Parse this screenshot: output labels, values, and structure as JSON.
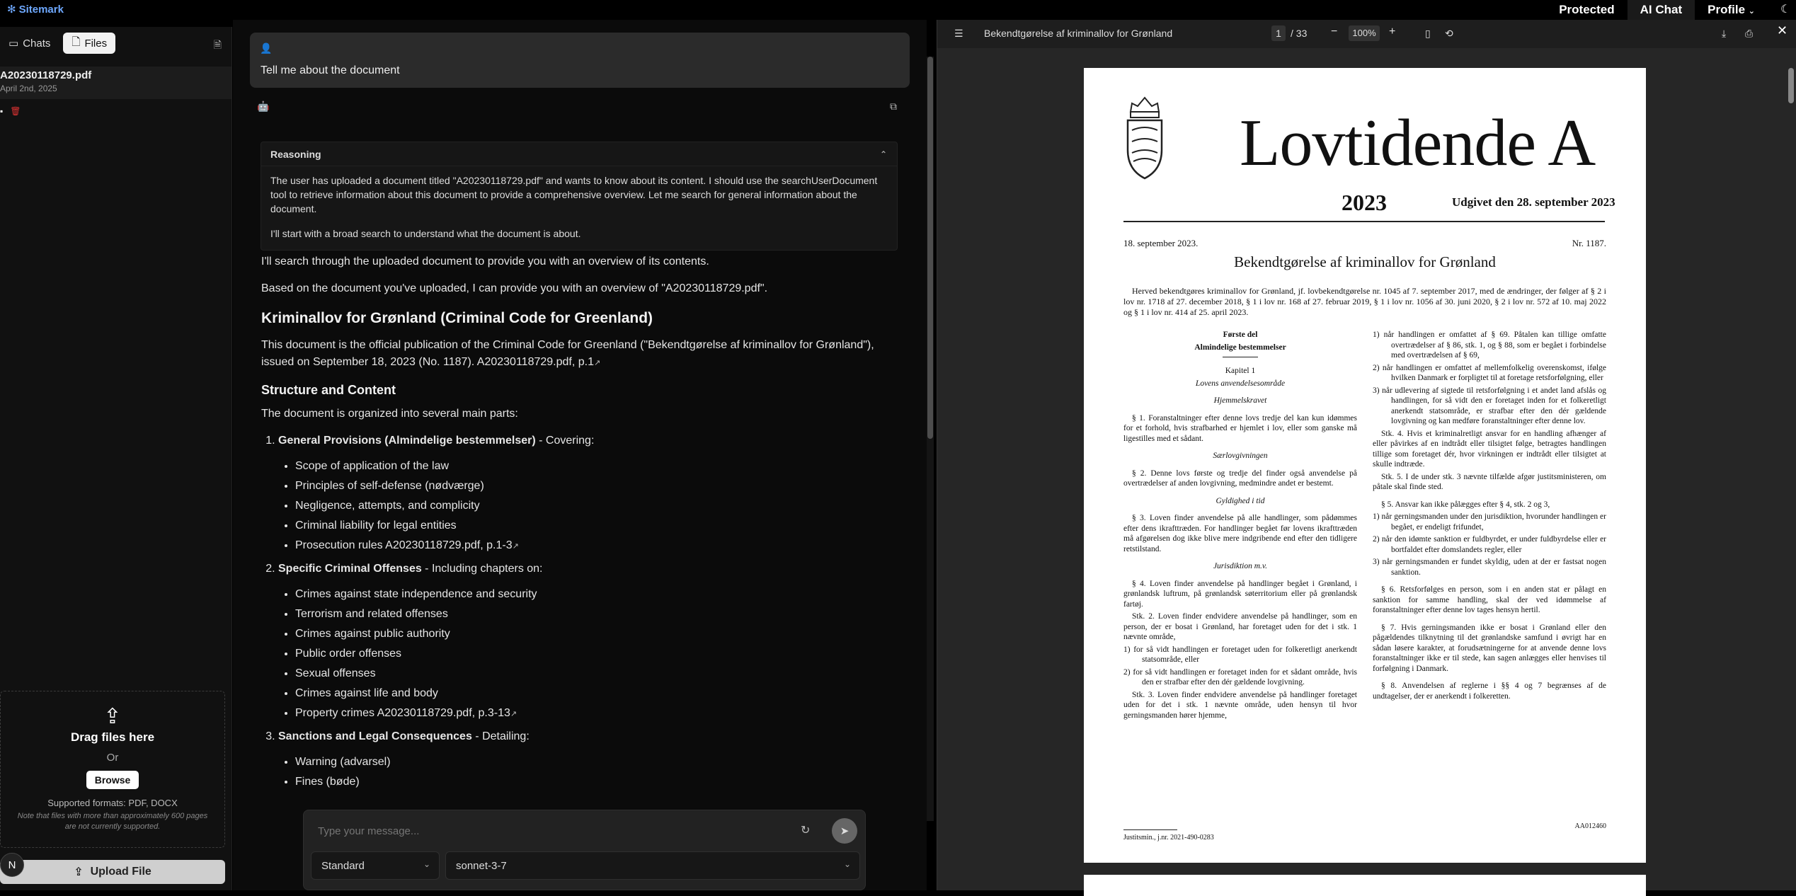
{
  "app": {
    "brand": "Sitemark",
    "nav": [
      "Protected",
      "AI Chat",
      "Profile"
    ],
    "nav_active": "AI Chat"
  },
  "sidebar": {
    "tabs": [
      "Chats",
      "Files"
    ],
    "active_tab": "Files",
    "document": {
      "name": "A20230118729.pdf",
      "date": "April 2nd, 2025"
    },
    "dropzone": {
      "title": "Drag files here",
      "or": "Or",
      "browse": "Browse",
      "formats": "Supported formats: PDF, DOCX",
      "note": "Note that files with more than approximately 600 pages are not currently supported."
    },
    "upload_button": "Upload File",
    "avatar_initial": "N"
  },
  "chat": {
    "user_message": "Tell me about the document",
    "reasoning": {
      "title": "Reasoning",
      "p1": "The user has uploaded a document titled \"A20230118729.pdf\" and wants to know about its content. I should use the searchUserDocument tool to retrieve information about this document to provide a comprehensive overview. Let me search for general information about the document.",
      "p2": "I'll start with a broad search to understand what the document is about."
    },
    "answer": {
      "intro1": "I'll search through the uploaded document to provide you with an overview of its contents.",
      "intro2": "Based on the document you've uploaded, I can provide you with an overview of \"A20230118729.pdf\".",
      "h1": "Kriminallov for Grønland (Criminal Code for Greenland)",
      "p1": "This document is the official publication of the Criminal Code for Greenland (\"Bekendtgørelse af kriminallov for Grønland\"), issued on September 18, 2023 (No. 1187). A20230118729.pdf, p.1",
      "h2": "Structure and Content",
      "p2": "The document is organized into several main parts:",
      "sections": [
        {
          "title": "General Provisions (Almindelige bestemmelser)",
          "suffix": " - Covering:",
          "items": [
            "Scope of application of the law",
            "Principles of self-defense (nødværge)",
            "Negligence, attempts, and complicity",
            "Criminal liability for legal entities",
            "Prosecution rules A20230118729.pdf, p.1-3"
          ]
        },
        {
          "title": "Specific Criminal Offenses",
          "suffix": " - Including chapters on:",
          "items": [
            "Crimes against state independence and security",
            "Terrorism and related offenses",
            "Crimes against public authority",
            "Public order offenses",
            "Sexual offenses",
            "Crimes against life and body",
            "Property crimes A20230118729.pdf, p.3-13"
          ]
        },
        {
          "title": "Sanctions and Legal Consequences",
          "suffix": " - Detailing:",
          "items": [
            "Warning (advarsel)",
            "Fines (bøde)"
          ]
        }
      ]
    },
    "input_placeholder": "Type your message...",
    "mode_select": "Standard",
    "model_select": "sonnet-3-7"
  },
  "viewer": {
    "title": "Bekendtgørelse af kriminallov for Grønland",
    "page": "1",
    "total": "/ 33",
    "zoom": "100%",
    "pdf": {
      "masthead": "Lovtidende A",
      "year": "2023",
      "published": "Udgivet den 28. september 2023",
      "date": "18. september 2023.",
      "number": "Nr. 1187.",
      "doc_title": "Bekendtgørelse af kriminallov for Grønland",
      "intro": "Herved bekendtgøres kriminallov for Grønland, jf. lovbekendtgørelse nr. 1045 af 7. september 2017, med de ændringer, der følger af § 2 i lov nr. 1718 af 27. december 2018, § 1 i lov nr. 168 af 27. februar 2019, § 1 i lov nr. 1056 af 30. juni 2020, § 2 i lov nr. 572 af 10. maj 2022 og § 1 i lov nr. 414 af 25. april 2023.",
      "part_title_1": "Første del",
      "part_title_2": "Almindelige bestemmelser",
      "chapter": "Kapitel 1",
      "chapter_sub": "Lovens anvendelsesområde",
      "h_hjemmel": "Hjemmelskravet",
      "s1": "§ 1. Foranstaltninger efter denne lovs tredje del kan kun idømmes for et forhold, hvis strafbarhed er hjemlet i lov, eller som ganske må ligestilles med et sådant.",
      "h_saer": "Særlovgivningen",
      "s2": "§ 2. Denne lovs første og tredje del finder også anvendelse på overtrædelser af anden lovgivning, medmindre andet er bestemt.",
      "h_gyld": "Gyldighed i tid",
      "s3": "§ 3. Loven finder anvendelse på alle handlinger, som pådømmes efter dens ikrafttræden. For handlinger begået før lovens ikrafttræden må afgørelsen dog ikke blive mere indgribende end efter den tidligere retstilstand.",
      "h_jur": "Jurisdiktion m.v.",
      "s4": "§ 4. Loven finder anvendelse på handlinger begået i Grønland, i grønlandsk luftrum, på grønlandsk søterritorium eller på grønlandsk fartøj.",
      "s4_stk2": "Stk. 2. Loven finder endvidere anvendelse på handlinger, som en person, der er bosat i Grønland, har foretaget uden for det i stk. 1 nævnte område,",
      "s4_1": "1)   for så vidt handlingen er foretaget uden for folkeretligt anerkendt statsområde, eller",
      "s4_2": "2)   for så vidt handlingen er foretaget inden for et sådant område, hvis den er strafbar efter den dér gældende lovgivning.",
      "s4_stk3": "Stk. 3. Loven finder endvidere anvendelse på handlinger foretaget uden for det i stk. 1 nævnte område, uden hensyn til hvor gerningsmanden hører hjemme,",
      "r1": "1)   når handlingen er omfattet af § 69. Påtalen kan tillige omfatte overtrædelser af § 86, stk. 1, og § 88, som er begået i forbindelse med overtrædelsen af § 69,",
      "r2": "2)   når handlingen er omfattet af mellemfolkelig overenskomst, ifølge hvilken Danmark er forpligtet til at foretage retsforfølgning, eller",
      "r3": "3)   når udlevering af sigtede til retsforfølgning i et andet land afslås og handlingen, for så vidt den er foretaget inden for et folkeretligt anerkendt statsområde, er strafbar efter den dér gældende lovgivning og kan medføre foranstaltninger efter denne lov.",
      "r_stk4": "Stk. 4. Hvis et kriminalretligt ansvar for en handling afhænger af eller påvirkes af en indtrådt eller tilsigtet følge, betragtes handlingen tillige som foretaget dér, hvor virkningen er indtrådt eller tilsigtet at skulle indtræde.",
      "r_stk5": "Stk. 5. I de under stk. 3 nævnte tilfælde afgør justitsministeren, om påtale skal finde sted.",
      "s5": "§ 5. Ansvar kan ikke pålægges efter § 4, stk. 2 og 3,",
      "s5_1": "1)   når gerningsmanden under den jurisdiktion, hvorunder handlingen er begået, er endeligt frifundet,",
      "s5_2": "2)   når den idømte sanktion er fuldbyrdet, er under fuldbyrdelse eller er bortfaldet efter domslandets regler, eller",
      "s5_3": "3)   når gerningsmanden er fundet skyldig, uden at der er fastsat nogen sanktion.",
      "s6": "§ 6. Retsforfølges en person, som i en anden stat er pålagt en sanktion for samme handling, skal der ved idømmelse af foranstaltninger efter denne lov tages hensyn hertil.",
      "s7": "§ 7. Hvis gerningsmanden ikke er bosat i Grønland eller den pågældendes tilknytning til det grønlandske samfund i øvrigt har en sådan løsere karakter, at forudsætningerne for at anvende denne lovs foranstaltninger ikke er til stede, kan sagen anlægges eller henvises til forfølgning i Danmark.",
      "s8": "§ 8. Anvendelsen af reglerne i §§ 4 og 7 begrænses af de undtagelser, der er anerkendt i folkeretten.",
      "footer_left": "Justitsmin., j.nr. 2021-490-0283",
      "footer_right": "AA012460"
    }
  }
}
